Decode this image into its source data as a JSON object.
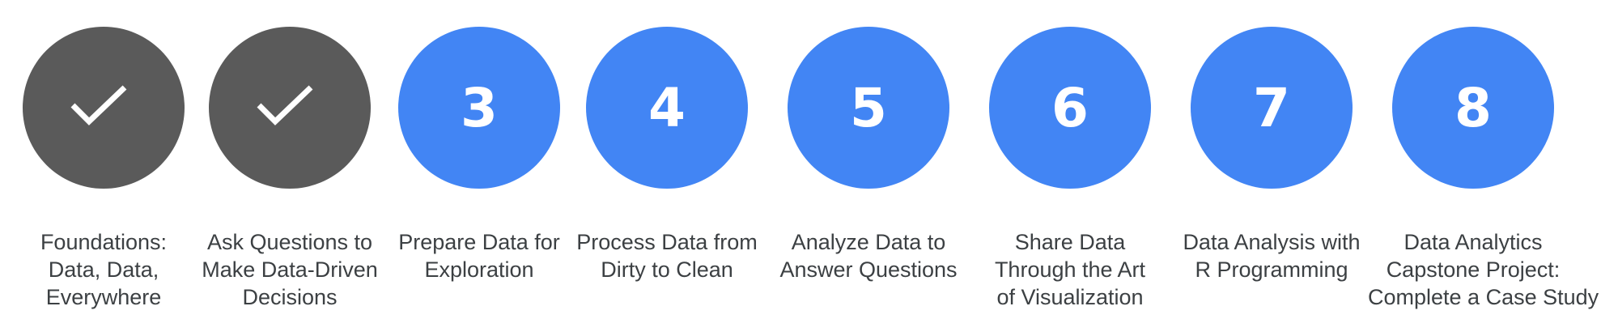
{
  "steps": [
    {
      "status": "complete",
      "icon": "checkmark-icon",
      "number": "",
      "label_lines": [
        "Foundations:",
        "Data, Data,",
        "Everywhere"
      ]
    },
    {
      "status": "complete",
      "icon": "checkmark-icon",
      "number": "",
      "label_lines": [
        "Ask Questions to",
        "Make Data-Driven",
        "Decisions"
      ]
    },
    {
      "status": "upcoming",
      "icon": "",
      "number": "3",
      "label_lines": [
        "Prepare Data for",
        "Exploration"
      ]
    },
    {
      "status": "upcoming",
      "icon": "",
      "number": "4",
      "label_lines": [
        "Process Data from",
        "Dirty to Clean"
      ]
    },
    {
      "status": "upcoming",
      "icon": "",
      "number": "5",
      "label_lines": [
        "Analyze Data to",
        "Answer Questions"
      ]
    },
    {
      "status": "upcoming",
      "icon": "",
      "number": "6",
      "label_lines": [
        "Share Data",
        "Through the Art",
        "of Visualization"
      ]
    },
    {
      "status": "upcoming",
      "icon": "",
      "number": "7",
      "label_lines": [
        "Data Analysis with",
        "R Programming"
      ]
    },
    {
      "status": "upcoming",
      "icon": "",
      "number": "8",
      "label_lines": [
        "Data Analytics",
        "Capstone Project:",
        "Complete a Case Study"
      ]
    }
  ],
  "colors": {
    "complete": "#5a5a5a",
    "upcoming": "#4285f4",
    "label_text": "#3c4043"
  }
}
